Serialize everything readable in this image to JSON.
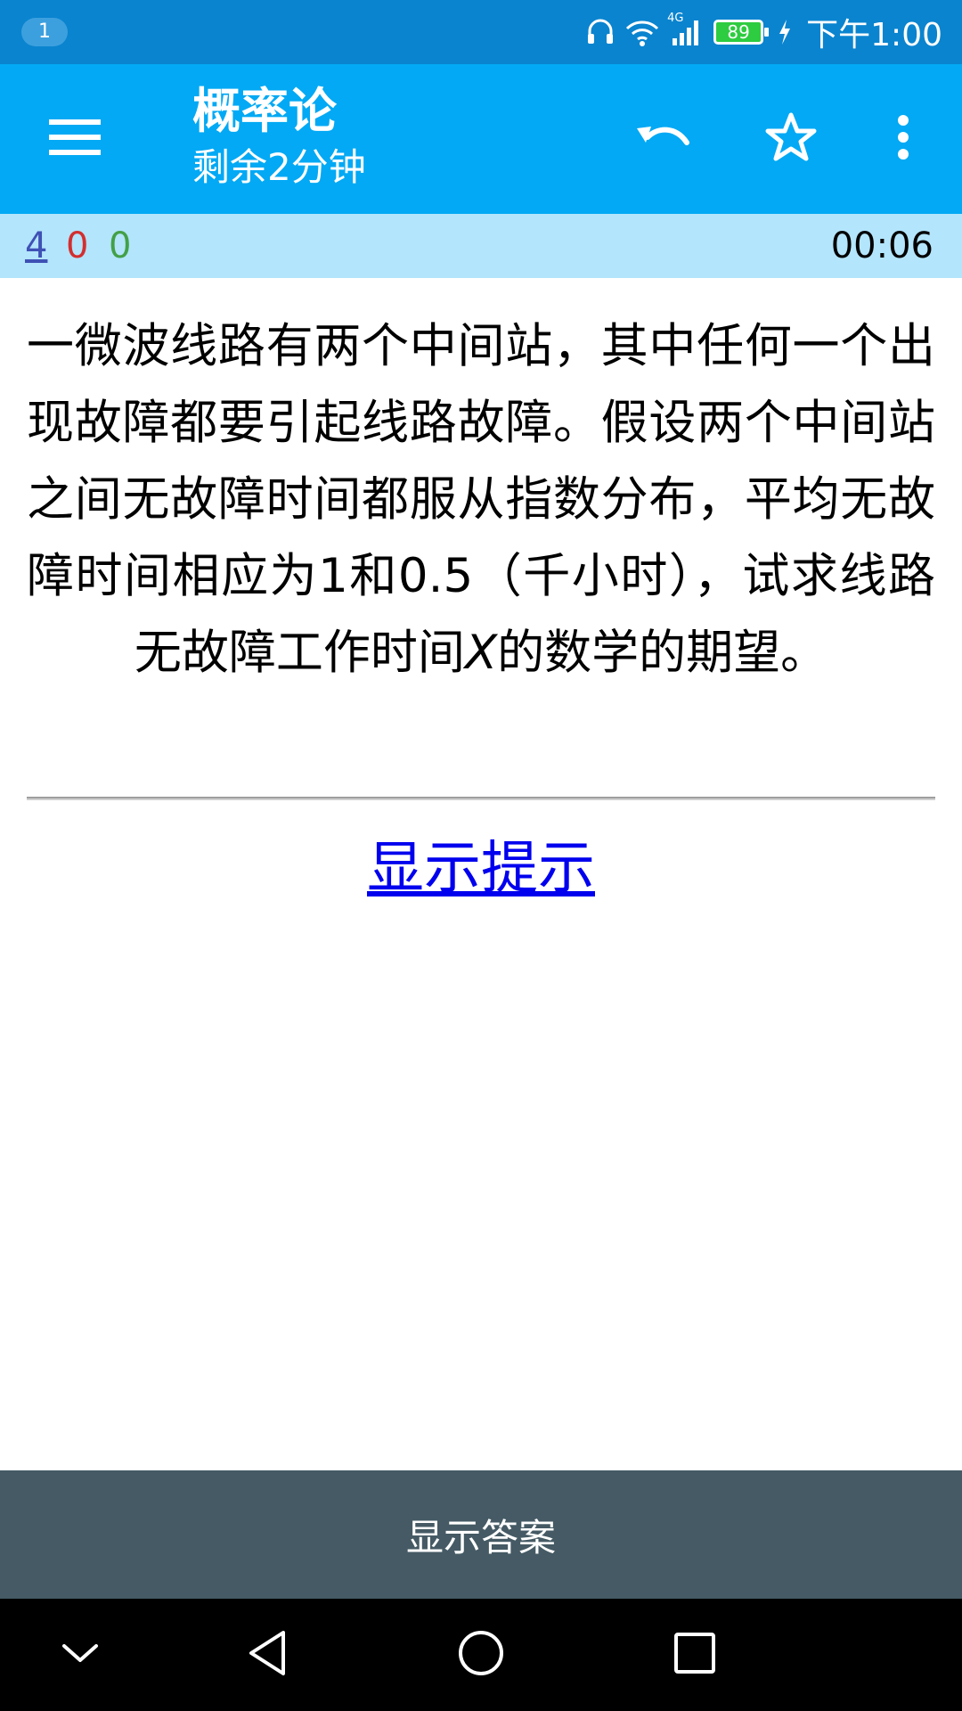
{
  "status_bar": {
    "notification_count": "1",
    "network_label": "4G",
    "battery": "89",
    "time": "下午1:00",
    "icons": [
      "headset-icon",
      "wifi-icon",
      "signal-icon",
      "battery-icon",
      "charging-icon"
    ]
  },
  "toolbar": {
    "title": "概率论",
    "subtitle": "剩余2分钟",
    "icons": [
      "menu-icon",
      "undo-icon",
      "star-outline-icon",
      "more-vert-icon"
    ]
  },
  "score_bar": {
    "total": "4",
    "wrong": "0",
    "correct": "0",
    "timer": "00:06"
  },
  "question": {
    "text_before": "一微波线路有两个中间站，其中任何一个出现故障都要引起线路故障。假设两个中间站之间无故障时间都服从指数分布，平均无故障时间相应为1和0.5（千小时），试求线路无故障工作时间",
    "variable": "X",
    "text_after": "的数学的期望。"
  },
  "hint_link": "显示提示",
  "answer_button": "显示答案",
  "colors": {
    "status_bar": "#0a84cf",
    "toolbar": "#03a9f4",
    "score_bar": "#b3e5fc",
    "answer_bar": "#455a64",
    "nav_bar": "#000000",
    "score_total": "#3f51b5",
    "score_wrong": "#d32f2f",
    "score_correct": "#43a047",
    "link": "#0000ee"
  },
  "nav_bar": {
    "icons": [
      "chevron-down-icon",
      "back-triangle-icon",
      "home-circle-icon",
      "recents-square-icon"
    ]
  }
}
